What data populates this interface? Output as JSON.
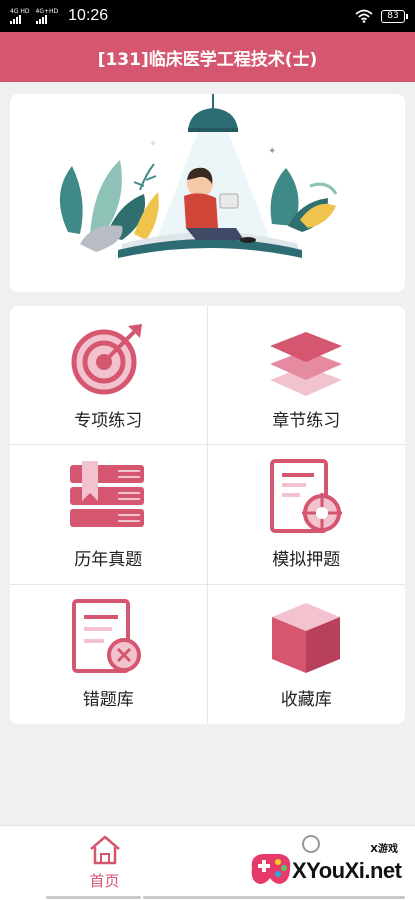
{
  "status_bar": {
    "signal1_label": "4G HD",
    "signal2_label": "4G+HD",
    "time": "10:26",
    "battery": "83"
  },
  "header": {
    "title": "[131]临床医学工程技术(士)"
  },
  "banner": {
    "illustration": "child-reading-book-under-lamp"
  },
  "menu": {
    "items": [
      {
        "label": "专项练习",
        "icon": "target-arrow-icon"
      },
      {
        "label": "章节练习",
        "icon": "layers-icon"
      },
      {
        "label": "历年真题",
        "icon": "books-icon"
      },
      {
        "label": "模拟押题",
        "icon": "document-target-icon"
      },
      {
        "label": "错题库",
        "icon": "document-x-icon"
      },
      {
        "label": "收藏库",
        "icon": "cube-icon"
      }
    ]
  },
  "bottom_nav": {
    "home_label": "首页"
  },
  "watermark": {
    "small": "X游戏",
    "text": "XYouXi.net"
  },
  "colors": {
    "accent": "#d5566f",
    "accent_light": "#f2c3cf",
    "background": "#f0f0f3"
  }
}
